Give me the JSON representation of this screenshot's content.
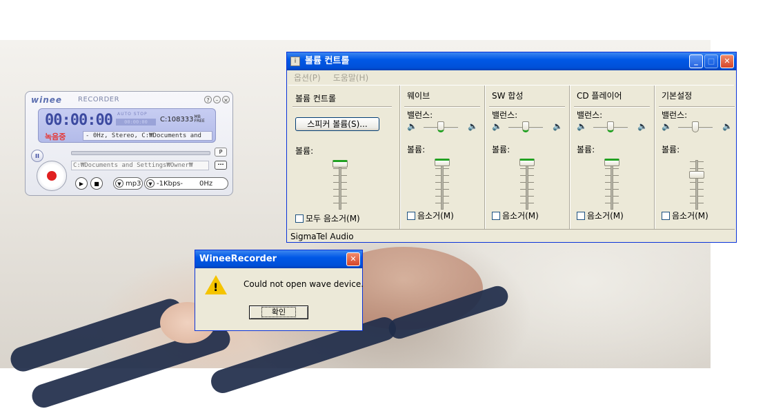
{
  "winee": {
    "logo": "winee",
    "logo_sub": "RECORDER",
    "sys_buttons": [
      "?",
      "–",
      "×"
    ],
    "time": "00:00:00",
    "autostop_label": "AUTO STOP",
    "autostop_value": "00:00:00",
    "free_value": "C:108333",
    "free_unit_top": "MB",
    "free_unit_bottom": "FREE",
    "status": "녹음중",
    "format_info": "- 0Hz, Stereo, C:₩Documents and",
    "pause_label": "II",
    "p_button": "P",
    "save_path": "C:₩Documents and Settings₩Owner₩",
    "browse_label": "···",
    "play_label": "▶",
    "stop_label": "■",
    "codec": "mp3",
    "bitrate": "-1Kbps-",
    "samplerate": "0Hz"
  },
  "volume": {
    "title": "볼륨 컨트롤",
    "menu": [
      "옵션(P)",
      "도움말(H)"
    ],
    "master": {
      "title": "볼륨 컨트롤",
      "speaker_button": "스피커 볼륨(S)...",
      "volume_label": "볼륨:",
      "mute_label": "모두 음소거(M)",
      "level": 0.95
    },
    "channels": [
      {
        "title": "웨이브",
        "balance_label": "밸런스:",
        "volume_label": "볼륨:",
        "mute_label": "음소거(M)",
        "level": 0.95,
        "balance": 0.5
      },
      {
        "title": "SW 합성",
        "balance_label": "밸런스:",
        "volume_label": "볼륨:",
        "mute_label": "음소거(M)",
        "level": 0.95,
        "balance": 0.5
      },
      {
        "title": "CD 플레이어",
        "balance_label": "밸런스:",
        "volume_label": "볼륨:",
        "mute_label": "음소거(M)",
        "level": 0.95,
        "balance": 0.5
      },
      {
        "title": "기본설정",
        "balance_label": "밸런스:",
        "volume_label": "볼륨:",
        "mute_label": "음소거(M)",
        "level": 0.7,
        "balance": 0.5
      }
    ],
    "status": "SigmaTel Audio"
  },
  "msgbox": {
    "title": "WineeRecorder",
    "message": "Could not open wave device.",
    "ok_label": "확인"
  }
}
